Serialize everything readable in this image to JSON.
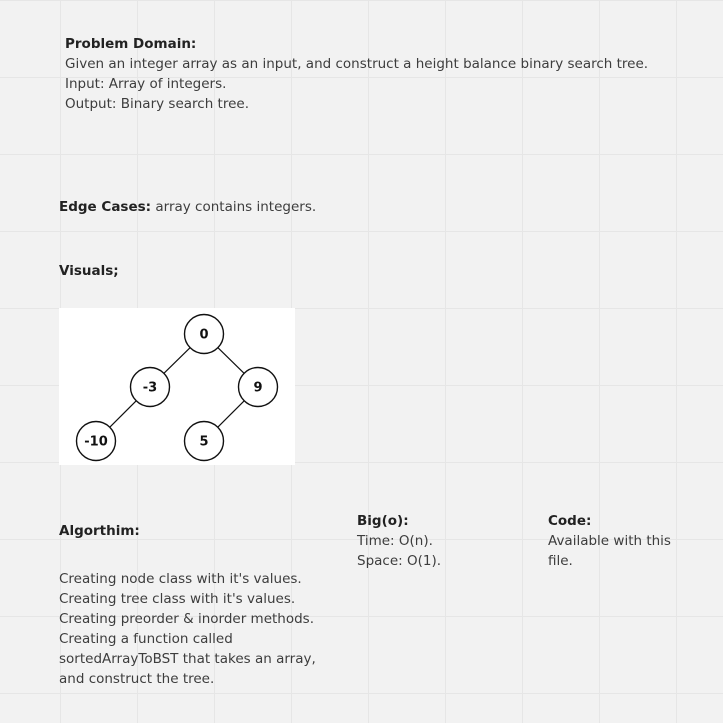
{
  "problem": {
    "title": "Problem Domain:",
    "lines": [
      "Given an integer array as an input, and construct a height balance binary search tree.",
      "Input: Array of integers.",
      "Output: Binary search tree."
    ]
  },
  "edge_cases": {
    "label": "Edge Cases:",
    "text": "array contains integers."
  },
  "visuals": {
    "label": "Visuals;"
  },
  "tree": {
    "nodes": [
      {
        "id": "n0",
        "label": "0"
      },
      {
        "id": "n-3",
        "label": "-3"
      },
      {
        "id": "n9",
        "label": "9"
      },
      {
        "id": "n-10",
        "label": "-10"
      },
      {
        "id": "n5",
        "label": "5"
      }
    ],
    "edges": [
      [
        "n0",
        "n-3"
      ],
      [
        "n0",
        "n9"
      ],
      [
        "n-3",
        "n-10"
      ],
      [
        "n9",
        "n5"
      ]
    ]
  },
  "algorithm": {
    "title": "Algorthim:",
    "lines": [
      "Creating node class with it's values.",
      "Creating tree class with it's values.",
      "Creating preorder & inorder methods.",
      "Creating a function called",
      "sortedArrayToBST that takes an array,",
      "and construct the tree."
    ]
  },
  "big_o": {
    "title": "Big(o):",
    "lines": [
      "Time: O(n).",
      "Space: O(1)."
    ]
  },
  "code": {
    "title": "Code:",
    "lines": [
      "Available with this",
      "file."
    ]
  }
}
